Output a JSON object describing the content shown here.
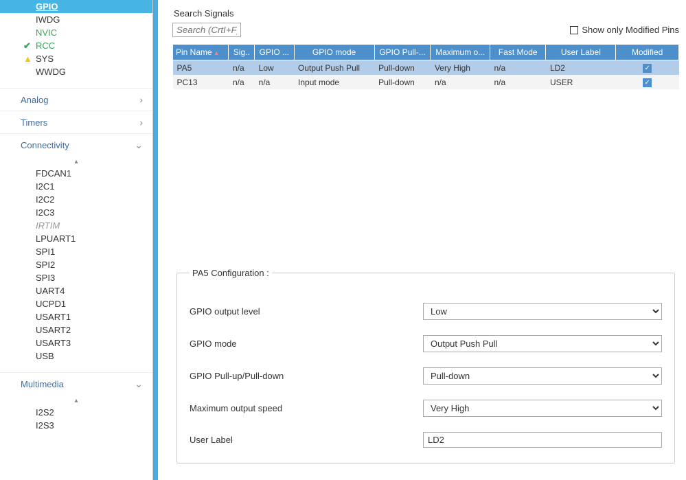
{
  "sidebar": {
    "sysItems": [
      {
        "label": "GPIO",
        "status": "",
        "active": true
      },
      {
        "label": "IWDG",
        "status": ""
      },
      {
        "label": "NVIC",
        "status": ""
      },
      {
        "label": "RCC",
        "status": "ok"
      },
      {
        "label": "SYS",
        "status": "warn"
      },
      {
        "label": "WWDG",
        "status": ""
      }
    ],
    "categories": [
      {
        "name": "Analog",
        "expanded": false
      },
      {
        "name": "Timers",
        "expanded": false
      }
    ],
    "connectivity": {
      "name": "Connectivity",
      "items": [
        {
          "label": "FDCAN1"
        },
        {
          "label": "I2C1"
        },
        {
          "label": "I2C2"
        },
        {
          "label": "I2C3"
        },
        {
          "label": "IRTIM",
          "disabled": true
        },
        {
          "label": "LPUART1"
        },
        {
          "label": "SPI1"
        },
        {
          "label": "SPI2"
        },
        {
          "label": "SPI3"
        },
        {
          "label": "UART4"
        },
        {
          "label": "UCPD1"
        },
        {
          "label": "USART1"
        },
        {
          "label": "USART2"
        },
        {
          "label": "USART3"
        },
        {
          "label": "USB"
        }
      ]
    },
    "multimedia": {
      "name": "Multimedia",
      "items": [
        {
          "label": "I2S2"
        },
        {
          "label": "I2S3"
        }
      ]
    }
  },
  "main": {
    "searchLabel": "Search Signals",
    "searchPlaceholder": "Search (CrtI+F)",
    "showOnlyModified": "Show only Modified Pins",
    "columns": [
      "Pin Name",
      "Sig..",
      "GPIO ...",
      "GPIO mode",
      "GPIO Pull-...",
      "Maximum o...",
      "Fast Mode",
      "User Label",
      "Modified"
    ],
    "rows": [
      {
        "pin": "PA5",
        "sig": "n/a",
        "lvl": "Low",
        "mode": "Output Push Pull",
        "pull": "Pull-down",
        "speed": "Very High",
        "fast": "n/a",
        "label": "LD2",
        "mod": true,
        "selected": true
      },
      {
        "pin": "PC13",
        "sig": "n/a",
        "lvl": "n/a",
        "mode": "Input mode",
        "pull": "Pull-down",
        "speed": "n/a",
        "fast": "n/a",
        "label": "USER",
        "mod": true,
        "selected": false
      }
    ]
  },
  "config": {
    "legend": "PA5 Configuration :",
    "fields": {
      "outputLevel": {
        "label": "GPIO output level",
        "value": "Low"
      },
      "mode": {
        "label": "GPIO mode",
        "value": "Output Push Pull"
      },
      "pull": {
        "label": "GPIO Pull-up/Pull-down",
        "value": "Pull-down"
      },
      "speed": {
        "label": "Maximum output speed",
        "value": "Very High"
      },
      "userLabel": {
        "label": "User Label",
        "value": "LD2"
      }
    }
  }
}
